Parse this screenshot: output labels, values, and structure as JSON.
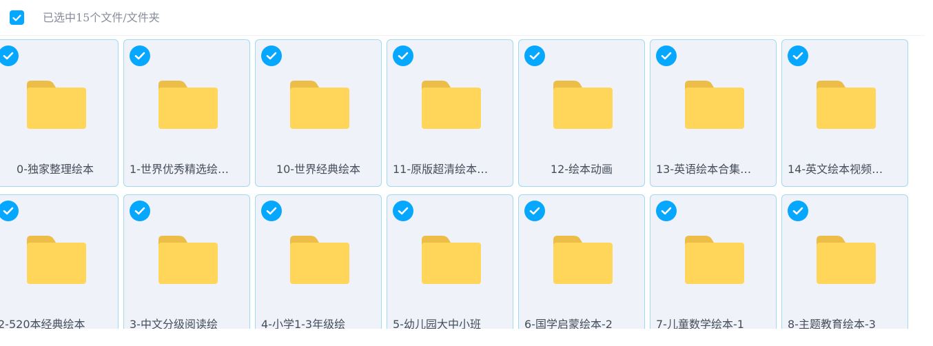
{
  "toolbar": {
    "select_all_checked": true,
    "selection_text": "已选中15个文件/文件夹"
  },
  "colors": {
    "accent": "#06a7ff",
    "tile_bg": "#eff2f9",
    "tile_border": "#9fd9f2",
    "folder_front": "#ffd659",
    "folder_back": "#ecbd47"
  },
  "folders": [
    {
      "name": "0-独家整理绘本",
      "display": "0-独家整理绘本",
      "selected": true
    },
    {
      "name": "1-世界优秀精选绘本",
      "display": "1-世界优秀精选绘…",
      "selected": true
    },
    {
      "name": "10-世界经典绘本",
      "display": "10-世界经典绘本",
      "selected": true
    },
    {
      "name": "11-原版超清绘本",
      "display": "11-原版超清绘本…",
      "selected": true
    },
    {
      "name": "12-绘本动画",
      "display": "12-绘本动画",
      "selected": true
    },
    {
      "name": "13-英语绘本合集",
      "display": "13-英语绘本合集…",
      "selected": true
    },
    {
      "name": "14-英文绘本视频",
      "display": "14-英文绘本视频…",
      "selected": true
    },
    {
      "name": "2-520本经典绘本",
      "display": "2-520本经典绘本",
      "selected": true
    },
    {
      "name": "3-中文分级阅读绘",
      "display": "3-中文分级阅读绘",
      "selected": true
    },
    {
      "name": "4-小学1-3年级绘",
      "display": "4-小学1-3年级绘",
      "selected": true
    },
    {
      "name": "5-幼儿园大中小班",
      "display": "5-幼儿园大中小班",
      "selected": true
    },
    {
      "name": "6-国学启蒙绘本-2",
      "display": "6-国学启蒙绘本-2",
      "selected": true
    },
    {
      "name": "7-儿童数学绘本-1",
      "display": "7-儿童数学绘本-1",
      "selected": true
    },
    {
      "name": "8-主题教育绘本-3",
      "display": "8-主题教育绘本-3",
      "selected": true
    }
  ]
}
